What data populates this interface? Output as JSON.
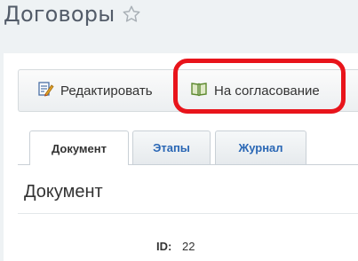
{
  "header": {
    "title": "Договоры",
    "favorite_icon": "star-icon"
  },
  "toolbar": {
    "edit": {
      "label": "Редактировать",
      "icon": "edit-document-icon"
    },
    "approve": {
      "label": "На согласование",
      "icon": "book-icon"
    },
    "highlight_color": "#e8141b"
  },
  "tabs": [
    {
      "label": "Документ",
      "active": true
    },
    {
      "label": "Этапы",
      "active": false
    },
    {
      "label": "Журнал",
      "active": false
    }
  ],
  "section": {
    "title": "Документ"
  },
  "fields": [
    {
      "label": "ID:",
      "value": "22"
    }
  ],
  "colors": {
    "tab_link": "#2a67b5",
    "title": "#535c69",
    "highlight": "#e8141b"
  }
}
